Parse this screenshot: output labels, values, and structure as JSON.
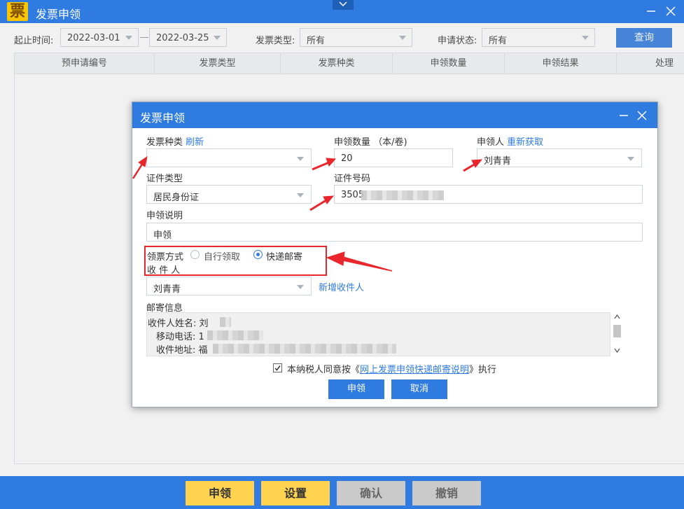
{
  "app": {
    "logo_char": "票",
    "title": "发票申领"
  },
  "filters": {
    "date_label": "起止时间:",
    "start_date": "2022-03-01",
    "end_date": "2022-03-25",
    "invoice_type_label": "发票类型:",
    "invoice_type_value": "所有",
    "status_label": "申请状态:",
    "status_value": "所有",
    "query_button": "查询"
  },
  "table": {
    "columns": [
      "预申请编号",
      "发票类型",
      "发票种类",
      "申领数量",
      "申领结果",
      "处理"
    ]
  },
  "bottom_bar": {
    "apply": "申领",
    "settings": "设置",
    "confirm": "确认",
    "cancel": "撤销"
  },
  "dialog": {
    "title": "发票申领",
    "invoice_kind_label": "发票种类",
    "refresh_link": "刷新",
    "invoice_kind_value": "",
    "quantity_label": "申领数量 （本/卷)",
    "quantity_value": "20",
    "applicant_label": "申领人",
    "reacquire_link": "重新获取",
    "applicant_value": "刘青青",
    "id_type_label": "证件类型",
    "id_type_value": "居民身份证",
    "id_number_label": "证件号码",
    "id_number_value": "3505",
    "description_label": "申领说明",
    "description_value": "申领",
    "pickup_method_label": "领票方式",
    "pickup_self": "自行领取",
    "pickup_express": "快递邮寄",
    "recipient_label": "收 件 人",
    "recipient_value": "刘青青",
    "add_recipient_link": "新增收件人",
    "mail_info_label": "邮寄信息",
    "mail_rows": {
      "name_label": "收件人姓名:",
      "name_value": "刘",
      "phone_label": "移动电话:",
      "phone_value": "1",
      "address_label": "收件地址:",
      "address_value": "福"
    },
    "agree_prefix": "本纳税人同意按《",
    "agree_link": "网上发票申领快递邮寄说明",
    "agree_suffix": "》执行",
    "submit_button": "申领",
    "cancel_button": "取消"
  },
  "colors": {
    "primary": "#2f7be0",
    "highlight": "#ffd34f",
    "annotation": "#e8262c"
  }
}
